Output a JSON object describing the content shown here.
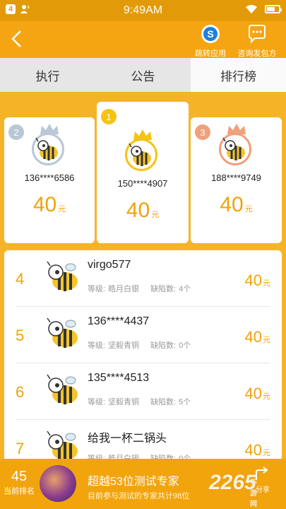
{
  "status_bar": {
    "notif_count": "4",
    "time": "9:49AM"
  },
  "header": {
    "jump_app_label": "跳转应用",
    "consult_label": "咨询发包方"
  },
  "tabs": [
    {
      "label": "执行"
    },
    {
      "label": "公告"
    },
    {
      "label": "排行榜"
    }
  ],
  "active_tab": "排行榜",
  "podium": [
    {
      "rank": "2",
      "phone": "136****6586",
      "amount": "40",
      "unit": "元"
    },
    {
      "rank": "1",
      "phone": "150****4907",
      "amount": "40",
      "unit": "元"
    },
    {
      "rank": "3",
      "phone": "188****9749",
      "amount": "40",
      "unit": "元"
    }
  ],
  "list_labels": {
    "level": "等级:",
    "defects": "缺陷数:"
  },
  "ranking": [
    {
      "rank": "4",
      "name": "virgo577",
      "level": "皓月白银",
      "defects": "4个",
      "amount": "40",
      "unit": "元"
    },
    {
      "rank": "5",
      "name": "136****4437",
      "level": "坚毅青铜",
      "defects": "0个",
      "amount": "40",
      "unit": "元"
    },
    {
      "rank": "6",
      "name": "135****4513",
      "level": "坚毅青铜",
      "defects": "5个",
      "amount": "40",
      "unit": "元"
    },
    {
      "rank": "7",
      "name": "给我一杯二锅头",
      "level": "皓月白银",
      "defects": "0个",
      "amount": "40",
      "unit": "元"
    }
  ],
  "my_rank": {
    "number": "45",
    "label": "当前排名"
  },
  "promo": {
    "title": "超越53位测试专家",
    "subtitle": "目前参与测试的专家共计98位"
  },
  "share_label": "分享",
  "watermark": {
    "text": "2265",
    "small": "手游网"
  },
  "colors": {
    "accent": "#f5a511",
    "amount": "#f0a20a",
    "rank1": "#f6c314",
    "rank2": "#b9c7d6",
    "rank3": "#f0a07a"
  }
}
